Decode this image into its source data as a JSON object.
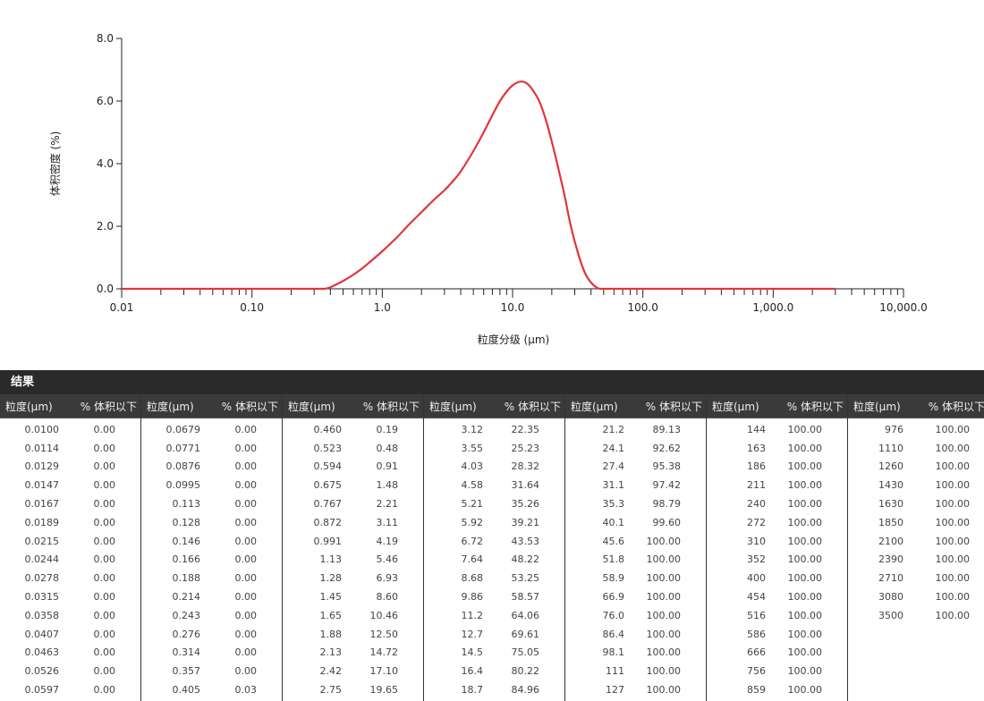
{
  "chart_data": {
    "type": "line",
    "xscale": "log",
    "xlim": [
      0.01,
      10000
    ],
    "ylim": [
      0,
      8
    ],
    "xticks": [
      {
        "value": 0.01,
        "label": "0.01"
      },
      {
        "value": 0.1,
        "label": "0.10"
      },
      {
        "value": 1,
        "label": "1.0"
      },
      {
        "value": 10,
        "label": "10.0"
      },
      {
        "value": 100,
        "label": "100.0"
      },
      {
        "value": 1000,
        "label": "1,000.0"
      },
      {
        "value": 10000,
        "label": "10,000.0"
      }
    ],
    "yticks": [
      {
        "value": 0,
        "label": "0.0"
      },
      {
        "value": 2,
        "label": "2.0"
      },
      {
        "value": 4,
        "label": "4.0"
      },
      {
        "value": 6,
        "label": "6.0"
      },
      {
        "value": 8,
        "label": "8.0"
      }
    ],
    "xlabel": "粒度分级 (μm)",
    "ylabel": "体积密度 (%)",
    "series_color": "#e0363b",
    "grid": false,
    "series": [
      {
        "x": [
          0.01,
          0.1,
          0.3,
          0.36,
          0.4,
          0.5,
          0.6,
          0.7,
          0.8,
          1.0,
          1.3,
          1.6,
          2.0,
          2.5,
          3.0,
          3.5,
          4.0,
          5.0,
          6.0,
          7.0,
          8.0,
          9.0,
          10.0,
          11.0,
          12.0,
          13.0,
          14.0,
          16.0,
          18.0,
          20.0,
          22.0,
          25.0,
          28.0,
          32.0,
          36.0,
          40.0,
          45.0,
          48.0,
          55.0,
          100.0,
          1000.0,
          3000.0
        ],
        "y": [
          0.0,
          0.0,
          0.0,
          0.0,
          0.05,
          0.25,
          0.45,
          0.65,
          0.85,
          1.2,
          1.65,
          2.05,
          2.45,
          2.85,
          3.15,
          3.45,
          3.75,
          4.4,
          5.0,
          5.55,
          6.0,
          6.3,
          6.5,
          6.6,
          6.62,
          6.55,
          6.4,
          6.0,
          5.4,
          4.7,
          4.0,
          3.0,
          2.0,
          1.1,
          0.5,
          0.2,
          0.02,
          0.0,
          0.0,
          0.0,
          0.0,
          0.0
        ]
      }
    ]
  },
  "results": {
    "title": "结果",
    "col_size": "粒度(μm)",
    "col_pct": "% 体积以下",
    "groups": [
      [
        [
          "0.0100",
          "0.00"
        ],
        [
          "0.0114",
          "0.00"
        ],
        [
          "0.0129",
          "0.00"
        ],
        [
          "0.0147",
          "0.00"
        ],
        [
          "0.0167",
          "0.00"
        ],
        [
          "0.0189",
          "0.00"
        ],
        [
          "0.0215",
          "0.00"
        ],
        [
          "0.0244",
          "0.00"
        ],
        [
          "0.0278",
          "0.00"
        ],
        [
          "0.0315",
          "0.00"
        ],
        [
          "0.0358",
          "0.00"
        ],
        [
          "0.0407",
          "0.00"
        ],
        [
          "0.0463",
          "0.00"
        ],
        [
          "0.0526",
          "0.00"
        ],
        [
          "0.0597",
          "0.00"
        ]
      ],
      [
        [
          "0.0679",
          "0.00"
        ],
        [
          "0.0771",
          "0.00"
        ],
        [
          "0.0876",
          "0.00"
        ],
        [
          "0.0995",
          "0.00"
        ],
        [
          "0.113",
          "0.00"
        ],
        [
          "0.128",
          "0.00"
        ],
        [
          "0.146",
          "0.00"
        ],
        [
          "0.166",
          "0.00"
        ],
        [
          "0.188",
          "0.00"
        ],
        [
          "0.214",
          "0.00"
        ],
        [
          "0.243",
          "0.00"
        ],
        [
          "0.276",
          "0.00"
        ],
        [
          "0.314",
          "0.00"
        ],
        [
          "0.357",
          "0.00"
        ],
        [
          "0.405",
          "0.03"
        ]
      ],
      [
        [
          "0.460",
          "0.19"
        ],
        [
          "0.523",
          "0.48"
        ],
        [
          "0.594",
          "0.91"
        ],
        [
          "0.675",
          "1.48"
        ],
        [
          "0.767",
          "2.21"
        ],
        [
          "0.872",
          "3.11"
        ],
        [
          "0.991",
          "4.19"
        ],
        [
          "1.13",
          "5.46"
        ],
        [
          "1.28",
          "6.93"
        ],
        [
          "1.45",
          "8.60"
        ],
        [
          "1.65",
          "10.46"
        ],
        [
          "1.88",
          "12.50"
        ],
        [
          "2.13",
          "14.72"
        ],
        [
          "2.42",
          "17.10"
        ],
        [
          "2.75",
          "19.65"
        ]
      ],
      [
        [
          "3.12",
          "22.35"
        ],
        [
          "3.55",
          "25.23"
        ],
        [
          "4.03",
          "28.32"
        ],
        [
          "4.58",
          "31.64"
        ],
        [
          "5.21",
          "35.26"
        ],
        [
          "5.92",
          "39.21"
        ],
        [
          "6.72",
          "43.53"
        ],
        [
          "7.64",
          "48.22"
        ],
        [
          "8.68",
          "53.25"
        ],
        [
          "9.86",
          "58.57"
        ],
        [
          "11.2",
          "64.06"
        ],
        [
          "12.7",
          "69.61"
        ],
        [
          "14.5",
          "75.05"
        ],
        [
          "16.4",
          "80.22"
        ],
        [
          "18.7",
          "84.96"
        ]
      ],
      [
        [
          "21.2",
          "89.13"
        ],
        [
          "24.1",
          "92.62"
        ],
        [
          "27.4",
          "95.38"
        ],
        [
          "31.1",
          "97.42"
        ],
        [
          "35.3",
          "98.79"
        ],
        [
          "40.1",
          "99.60"
        ],
        [
          "45.6",
          "100.00"
        ],
        [
          "51.8",
          "100.00"
        ],
        [
          "58.9",
          "100.00"
        ],
        [
          "66.9",
          "100.00"
        ],
        [
          "76.0",
          "100.00"
        ],
        [
          "86.4",
          "100.00"
        ],
        [
          "98.1",
          "100.00"
        ],
        [
          "111",
          "100.00"
        ],
        [
          "127",
          "100.00"
        ]
      ],
      [
        [
          "144",
          "100.00"
        ],
        [
          "163",
          "100.00"
        ],
        [
          "186",
          "100.00"
        ],
        [
          "211",
          "100.00"
        ],
        [
          "240",
          "100.00"
        ],
        [
          "272",
          "100.00"
        ],
        [
          "310",
          "100.00"
        ],
        [
          "352",
          "100.00"
        ],
        [
          "400",
          "100.00"
        ],
        [
          "454",
          "100.00"
        ],
        [
          "516",
          "100.00"
        ],
        [
          "586",
          "100.00"
        ],
        [
          "666",
          "100.00"
        ],
        [
          "756",
          "100.00"
        ],
        [
          "859",
          "100.00"
        ]
      ],
      [
        [
          "976",
          "100.00"
        ],
        [
          "1110",
          "100.00"
        ],
        [
          "1260",
          "100.00"
        ],
        [
          "1430",
          "100.00"
        ],
        [
          "1630",
          "100.00"
        ],
        [
          "1850",
          "100.00"
        ],
        [
          "2100",
          "100.00"
        ],
        [
          "2390",
          "100.00"
        ],
        [
          "2710",
          "100.00"
        ],
        [
          "3080",
          "100.00"
        ],
        [
          "3500",
          "100.00"
        ]
      ]
    ]
  }
}
